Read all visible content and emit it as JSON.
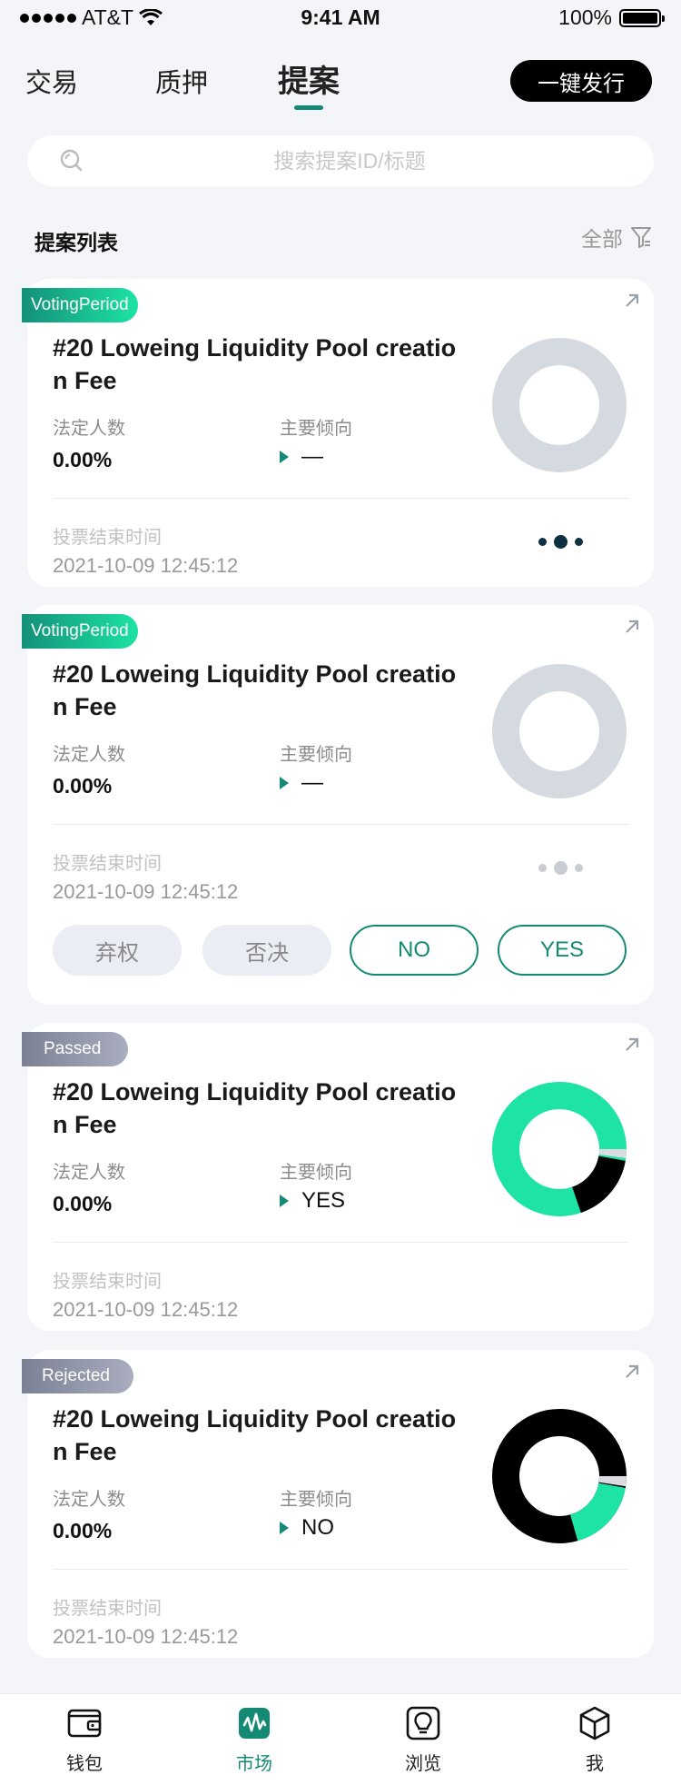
{
  "status_bar": {
    "carrier": "AT&T",
    "time": "9:41 AM",
    "battery": "100%"
  },
  "top_tabs": [
    {
      "label": "交易"
    },
    {
      "label": "质押"
    },
    {
      "label": "提案"
    }
  ],
  "issue_button": "一键发行",
  "search": {
    "placeholder": "搜索提案ID/标题"
  },
  "list": {
    "title": "提案列表",
    "filter_label": "全部"
  },
  "labels": {
    "quorum": "法定人数",
    "tendency": "主要倾向",
    "end_time": "投票结束时间"
  },
  "proposals": [
    {
      "status": "VotingPeriod",
      "title": "#20 Loweing Liquidity Pool creation Fee",
      "quorum": "0.00%",
      "tendency": "—",
      "end_time": "2021-10-09 12:45:12"
    },
    {
      "status": "VotingPeriod",
      "title": "#20 Loweing Liquidity Pool creation Fee",
      "quorum": "0.00%",
      "tendency": "—",
      "end_time": "2021-10-09 12:45:12"
    },
    {
      "status": "Passed",
      "title": "#20 Loweing Liquidity Pool creation Fee",
      "quorum": "0.00%",
      "tendency": "YES",
      "end_time": "2021-10-09 12:45:12"
    },
    {
      "status": "Rejected",
      "title": "#20 Loweing Liquidity Pool creation Fee",
      "quorum": "0.00%",
      "tendency": "NO",
      "end_time": "2021-10-09 12:45:12"
    }
  ],
  "vote_buttons": {
    "abstain": "弃权",
    "veto": "否决",
    "no": "NO",
    "yes": "YES"
  },
  "bottom_nav": [
    {
      "label": "钱包",
      "icon": "wallet-icon"
    },
    {
      "label": "市场",
      "icon": "market-icon"
    },
    {
      "label": "浏览",
      "icon": "browse-icon"
    },
    {
      "label": "我",
      "icon": "profile-icon"
    }
  ],
  "colors": {
    "accent": "#148a74",
    "yes": "#1de3a4",
    "no": "#000000",
    "empty": "#d5d9e0"
  }
}
